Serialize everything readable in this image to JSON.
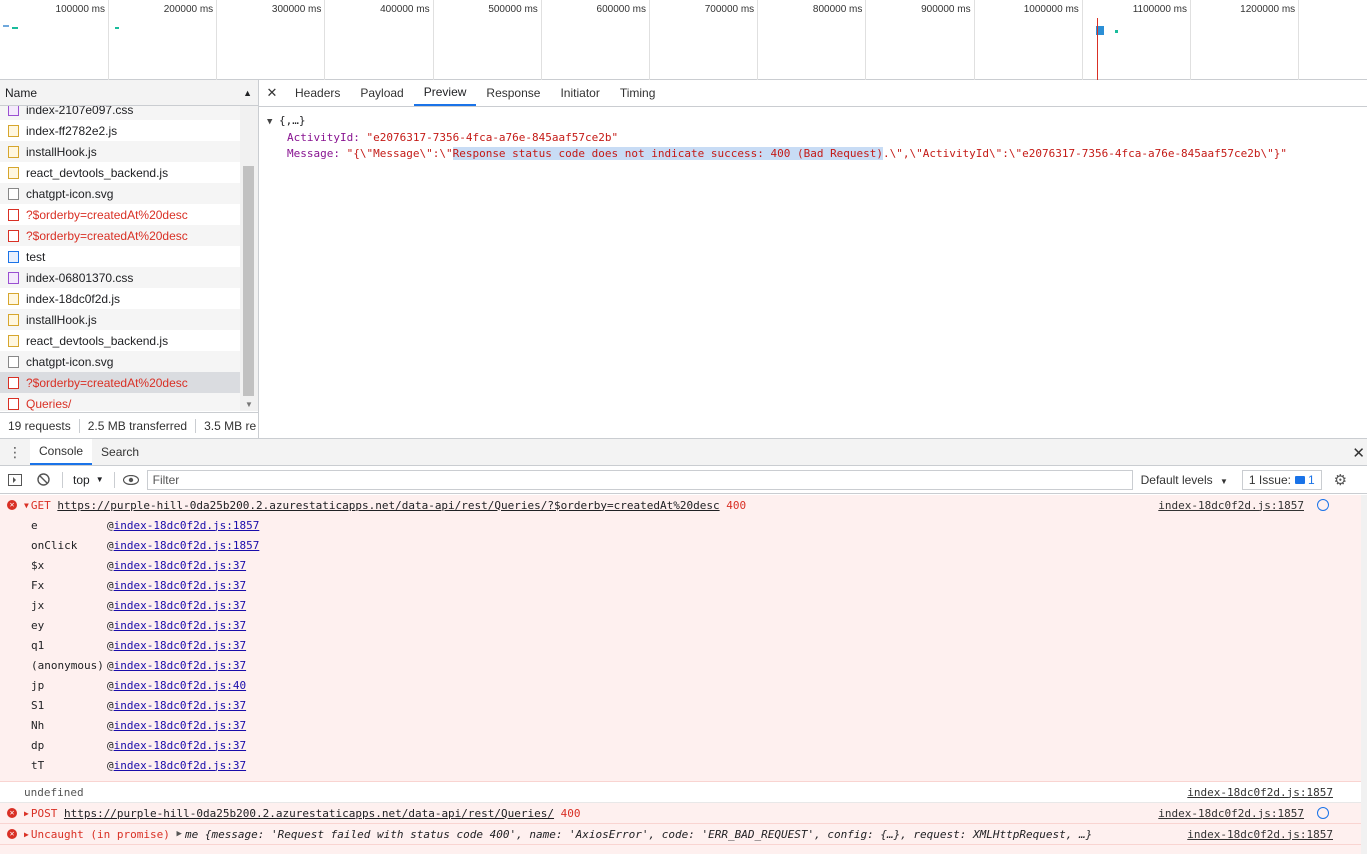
{
  "timeline": {
    "labels": [
      "100000 ms",
      "200000 ms",
      "300000 ms",
      "400000 ms",
      "500000 ms",
      "600000 ms",
      "700000 ms",
      "800000 ms",
      "900000 ms",
      "1000000 ms",
      "1100000 ms",
      "1200000 ms",
      "130"
    ]
  },
  "request_list": {
    "header_name": "Name",
    "rows": [
      {
        "name": "index-2107e097.css",
        "type": "css",
        "error": false
      },
      {
        "name": "index-ff2782e2.js",
        "type": "js",
        "error": false
      },
      {
        "name": "installHook.js",
        "type": "js",
        "error": false
      },
      {
        "name": "react_devtools_backend.js",
        "type": "js",
        "error": false
      },
      {
        "name": "chatgpt-icon.svg",
        "type": "svg",
        "error": false
      },
      {
        "name": "?$orderby=createdAt%20desc",
        "type": "err",
        "error": true
      },
      {
        "name": "?$orderby=createdAt%20desc",
        "type": "err",
        "error": true
      },
      {
        "name": "test",
        "type": "doc",
        "error": false
      },
      {
        "name": "index-06801370.css",
        "type": "css",
        "error": false
      },
      {
        "name": "index-18dc0f2d.js",
        "type": "js",
        "error": false
      },
      {
        "name": "installHook.js",
        "type": "js",
        "error": false
      },
      {
        "name": "react_devtools_backend.js",
        "type": "js",
        "error": false
      },
      {
        "name": "chatgpt-icon.svg",
        "type": "svg",
        "error": false
      },
      {
        "name": "?$orderby=createdAt%20desc",
        "type": "err",
        "error": true
      },
      {
        "name": "Queries/",
        "type": "err",
        "error": true
      }
    ],
    "status": {
      "requests": "19 requests",
      "transferred": "2.5 MB transferred",
      "resources": "3.5 MB re"
    }
  },
  "detail": {
    "tabs": [
      "Headers",
      "Payload",
      "Preview",
      "Response",
      "Initiator",
      "Timing"
    ],
    "active_tab": "Preview",
    "preview": {
      "root": "{,…}",
      "activity_key": "ActivityId",
      "activity_value": "\"e2076317-7356-4fca-a76e-845aaf57ce2b\"",
      "message_key": "Message",
      "message_prefix": "\"{\\\"Message\\\":\\\"",
      "message_highlight": "Response status code does not indicate success: 400 (Bad Request)",
      "message_suffix": ".\\\",\\\"ActivityId\\\":\\\"e2076317-7356-4fca-a76e-845aaf57ce2b\\\"}\""
    }
  },
  "drawer": {
    "tabs": [
      "Console",
      "Search"
    ],
    "active_tab": "Console"
  },
  "console_toolbar": {
    "context": "top",
    "filter_placeholder": "Filter",
    "levels": "Default levels",
    "issues_label": "1 Issue:",
    "issues_count": "1"
  },
  "console": {
    "get_error": {
      "method": "GET",
      "url": "https://purple-hill-0da25b200.2.azurestaticapps.net/data-api/rest/Queries/?$orderby=createdAt%20desc",
      "status": "400",
      "source": "index-18dc0f2d.js:1857",
      "stack": [
        {
          "fn": "e",
          "loc": "index-18dc0f2d.js:1857"
        },
        {
          "fn": "onClick",
          "loc": "index-18dc0f2d.js:1857"
        },
        {
          "fn": "$x",
          "loc": "index-18dc0f2d.js:37"
        },
        {
          "fn": "Fx",
          "loc": "index-18dc0f2d.js:37"
        },
        {
          "fn": "jx",
          "loc": "index-18dc0f2d.js:37"
        },
        {
          "fn": "ey",
          "loc": "index-18dc0f2d.js:37"
        },
        {
          "fn": "q1",
          "loc": "index-18dc0f2d.js:37"
        },
        {
          "fn": "(anonymous)",
          "loc": "index-18dc0f2d.js:37"
        },
        {
          "fn": "jp",
          "loc": "index-18dc0f2d.js:40"
        },
        {
          "fn": "S1",
          "loc": "index-18dc0f2d.js:37"
        },
        {
          "fn": "Nh",
          "loc": "index-18dc0f2d.js:37"
        },
        {
          "fn": "dp",
          "loc": "index-18dc0f2d.js:37"
        },
        {
          "fn": "tT",
          "loc": "index-18dc0f2d.js:37"
        }
      ]
    },
    "undefined_log": {
      "text": "undefined",
      "source": "index-18dc0f2d.js:1857"
    },
    "post_error": {
      "method": "POST",
      "url": "https://purple-hill-0da25b200.2.azurestaticapps.net/data-api/rest/Queries/",
      "status": "400",
      "source": "index-18dc0f2d.js:1857"
    },
    "uncaught": {
      "prefix": "Uncaught (in promise)",
      "body": "me {message: 'Request failed with status code 400', name: 'AxiosError', code: 'ERR_BAD_REQUEST', config: {…}, request: XMLHttpRequest, …}",
      "source": "index-18dc0f2d.js:1857"
    }
  }
}
